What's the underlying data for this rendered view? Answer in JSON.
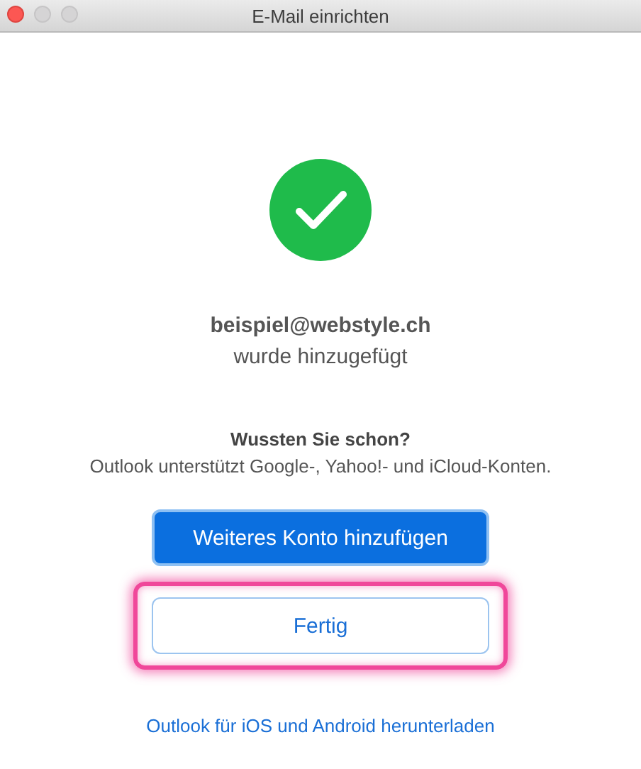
{
  "window": {
    "title": "E-Mail einrichten",
    "buttons": [
      {
        "kind": "close",
        "active": true
      },
      {
        "kind": "minimize",
        "active": false
      },
      {
        "kind": "zoom",
        "active": false
      }
    ]
  },
  "success": {
    "email": "beispiel@webstyle.ch",
    "message": "wurde hinzugefügt"
  },
  "tip": {
    "title": "Wussten Sie schon?",
    "text": "Outlook unterstützt Google-, Yahoo!- und iCloud-Konten."
  },
  "actions": [
    {
      "label": "Weiteres Konto hinzufügen",
      "kind": "primary",
      "highlighted": false
    },
    {
      "label": "Fertig",
      "kind": "secondary",
      "highlighted": true
    }
  ],
  "link": "Outlook für iOS und Android herunterladen"
}
